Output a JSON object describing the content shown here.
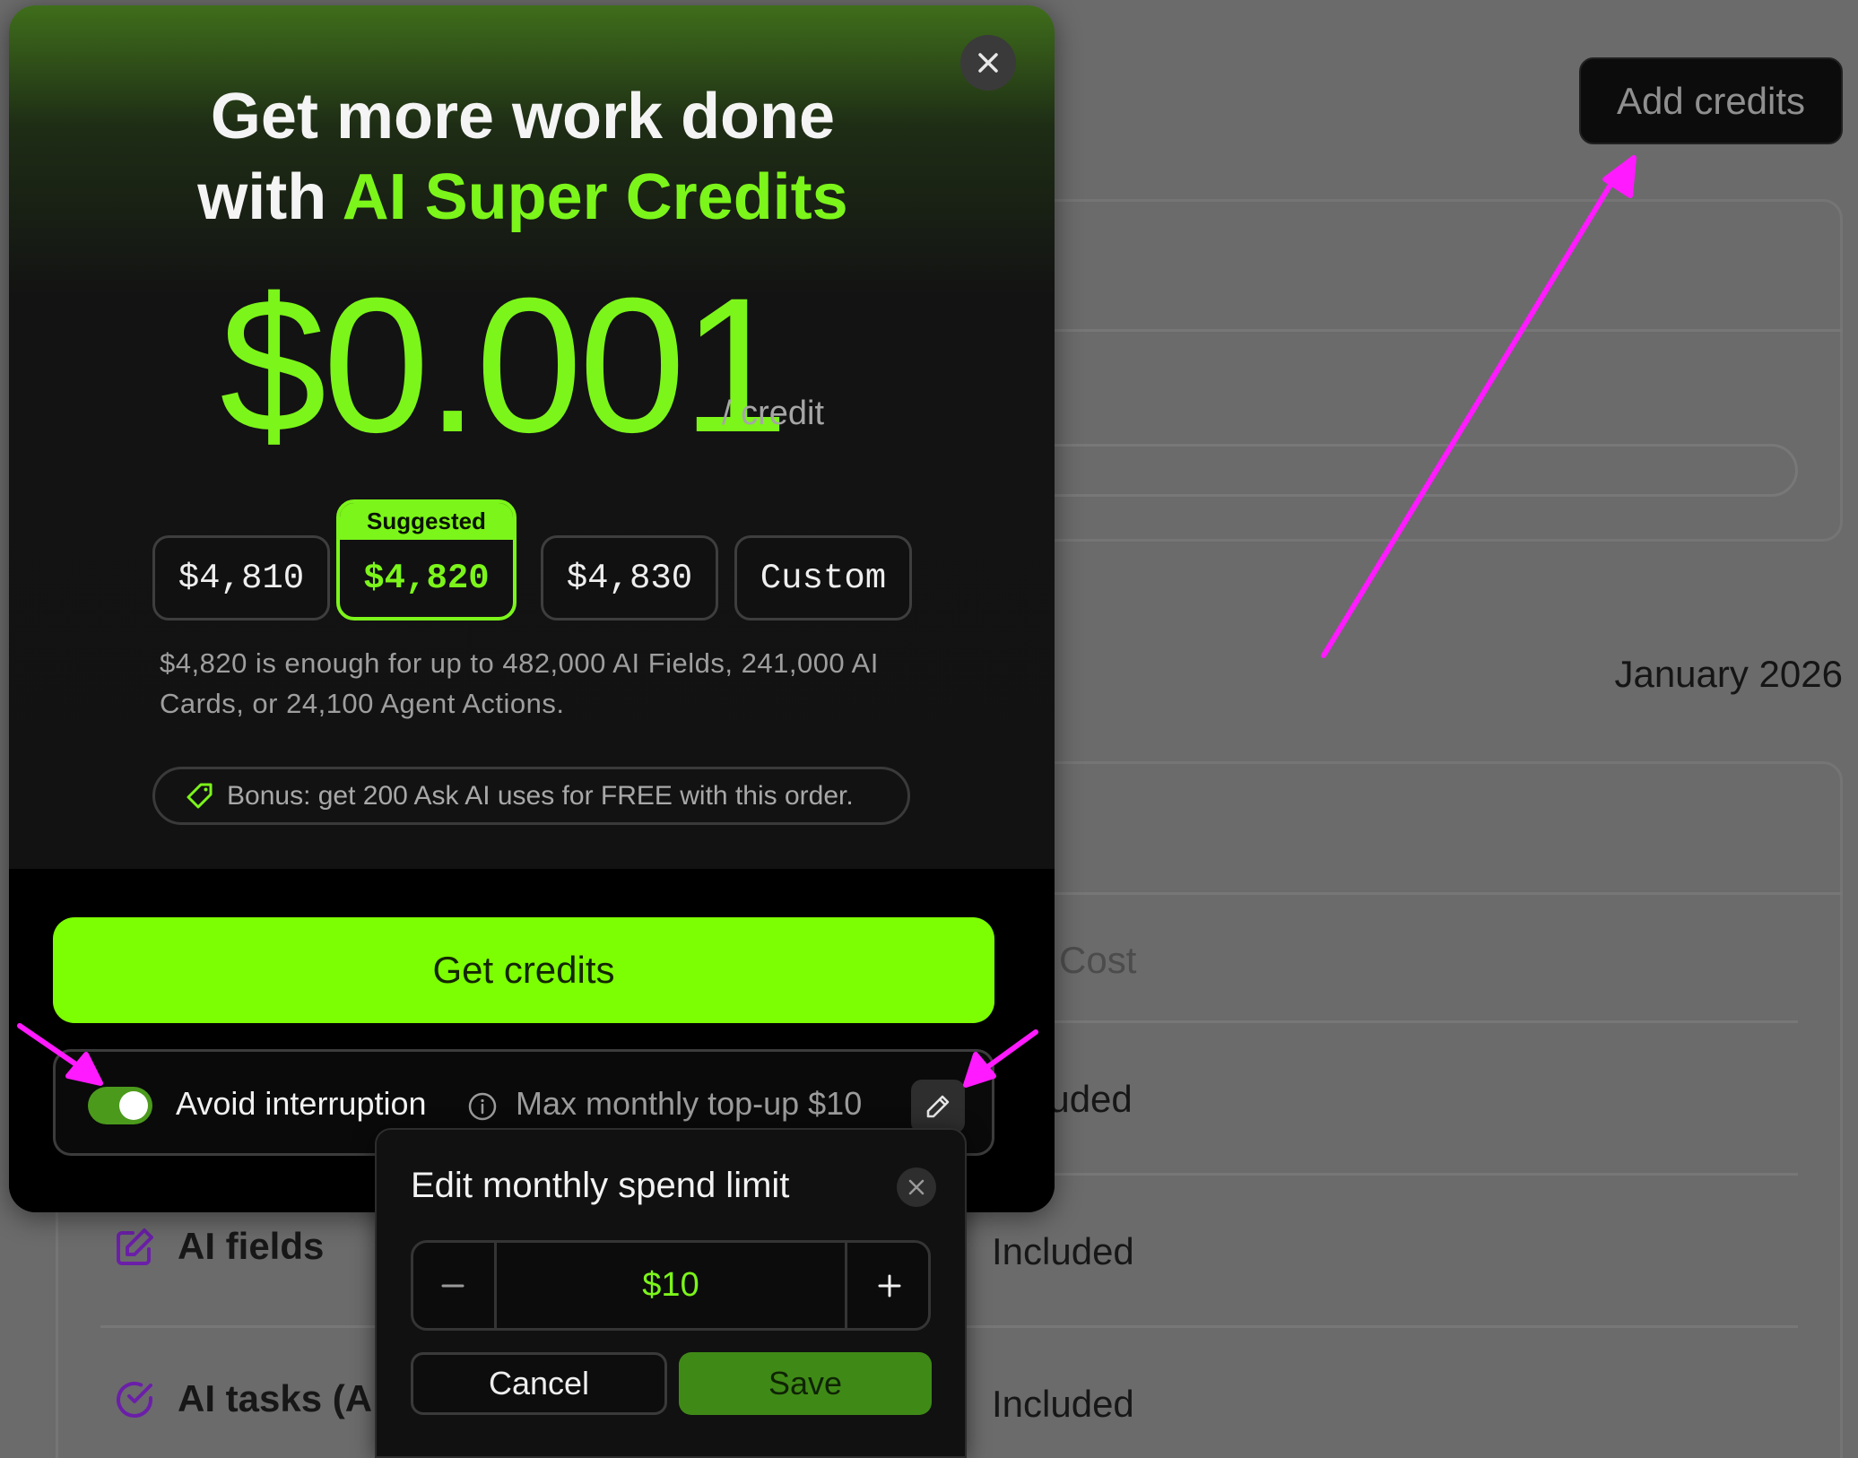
{
  "header": {
    "add_credits_label": "Add credits"
  },
  "billing": {
    "period": "January 2026",
    "cost_header_partial": "l Cost",
    "rows": [
      {
        "name": "",
        "value": "luded"
      },
      {
        "name": "AI fields",
        "icon": "edit-icon",
        "value": "Included"
      },
      {
        "name": "AI tasks (A",
        "icon": "check-circle-icon",
        "value": "Included"
      }
    ]
  },
  "modal": {
    "headline_line1": "Get more work done",
    "headline_prefix": "with ",
    "headline_accent": "AI Super Credits",
    "price": "$0.001",
    "price_unit": "/ credit",
    "amount_options": [
      {
        "label": "$4,810",
        "selected": false
      },
      {
        "label": "$4,820",
        "selected": true,
        "badge": "Suggested"
      },
      {
        "label": "$4,830",
        "selected": false
      },
      {
        "label": "Custom",
        "selected": false
      }
    ],
    "description": "$4,820 is enough for up to 482,000 AI Fields, 241,000 AI Cards, or 24,100 Agent Actions.",
    "bonus_text": "Bonus: get 200 Ask AI uses for FREE with this order.",
    "cta_label": "Get credits",
    "auto_topup": {
      "enabled": true,
      "label": "Avoid interruption",
      "max_text": "Max monthly top-up $10"
    }
  },
  "popover": {
    "title": "Edit monthly spend limit",
    "value": "$10",
    "cancel_label": "Cancel",
    "save_label": "Save"
  },
  "colors": {
    "accent_green": "#7cf51a",
    "cta_green": "#7dff03",
    "annotation_magenta": "#ff1aff",
    "purple_icon": "#8a2be2"
  }
}
